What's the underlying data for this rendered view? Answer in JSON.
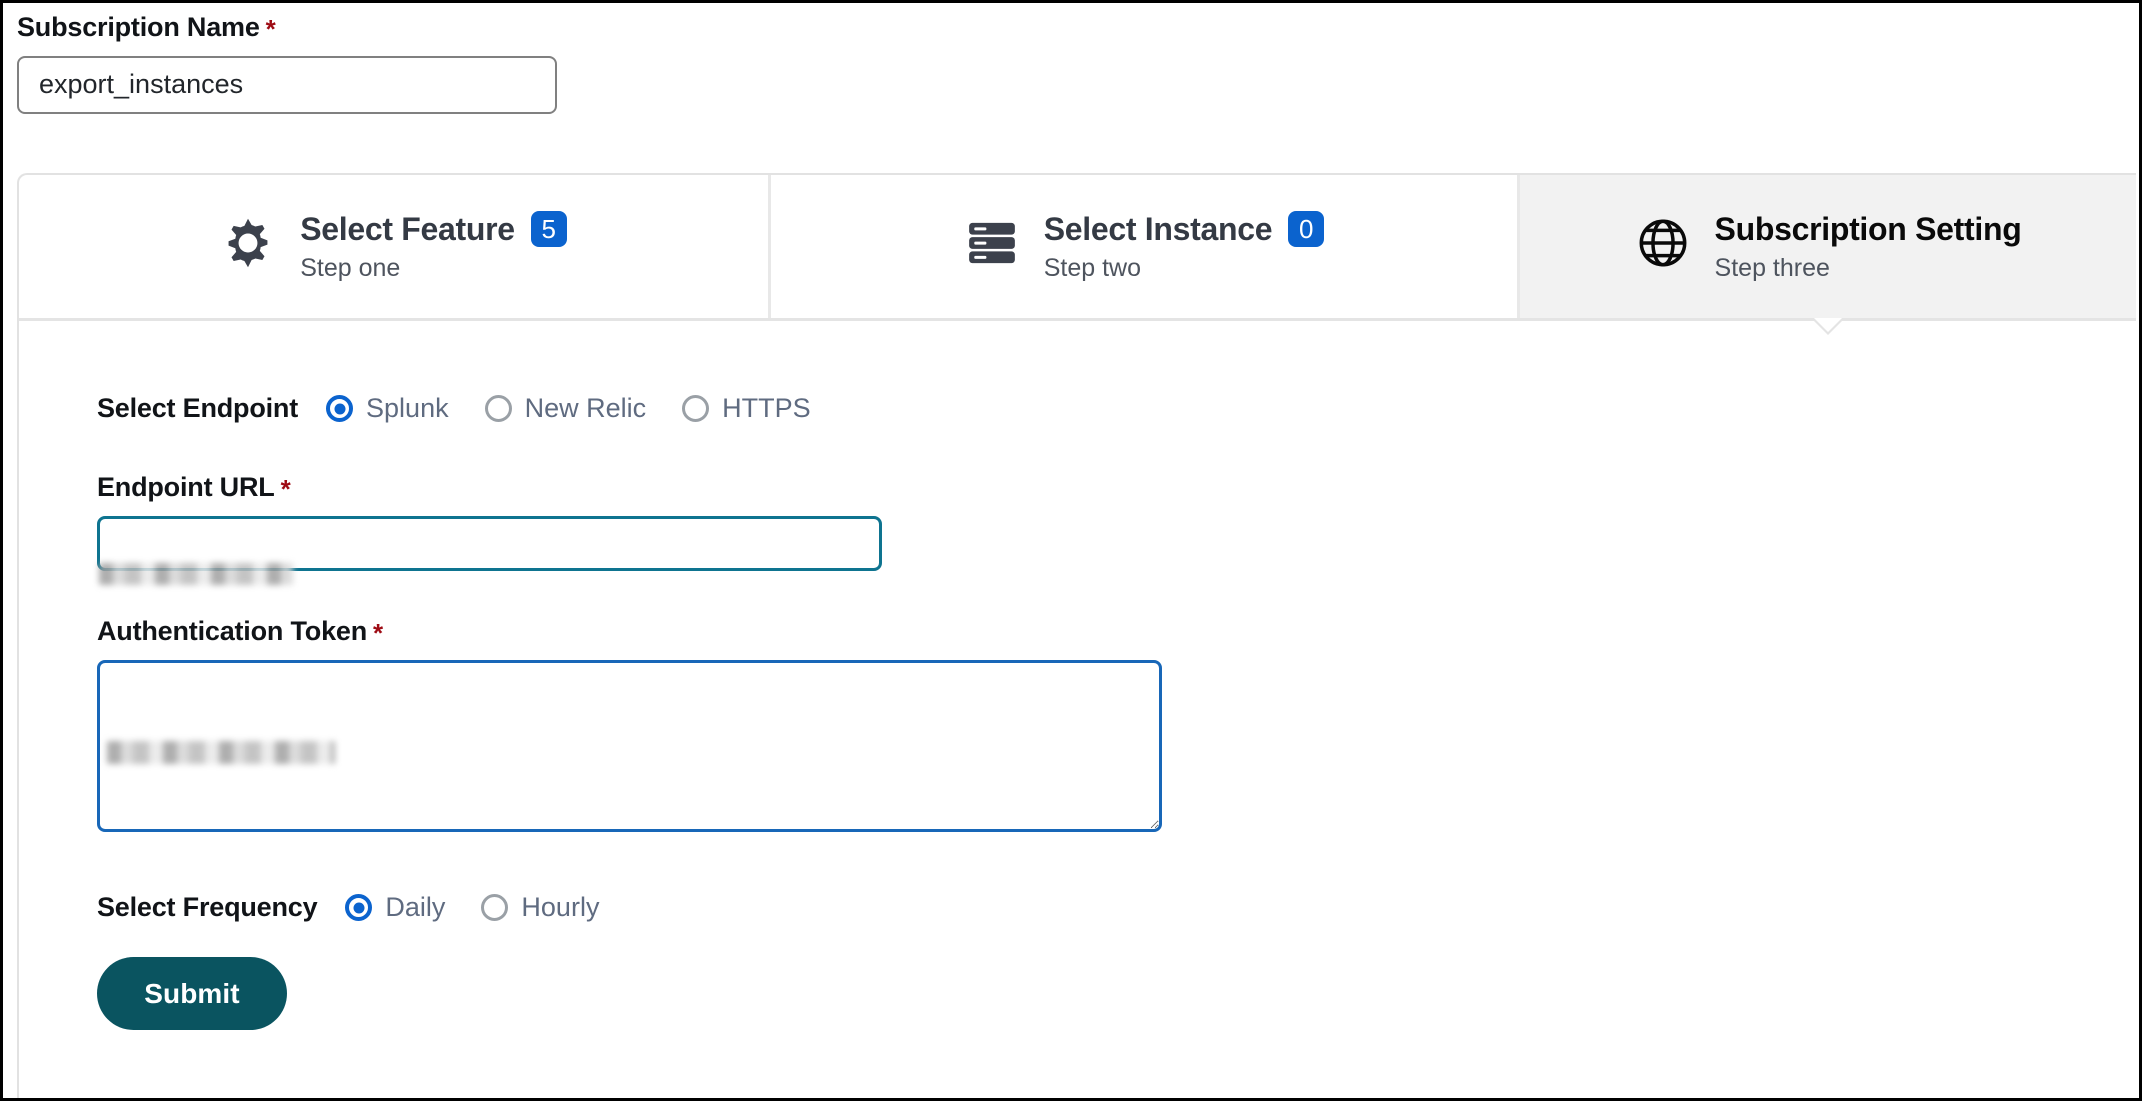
{
  "form": {
    "subscription_name": {
      "label": "Subscription Name",
      "required_marker": "*",
      "value": "export_instances",
      "placeholder": "Subscription Name"
    }
  },
  "stepper": {
    "tabs": [
      {
        "icon": "gear-icon",
        "title": "Select Feature",
        "badge": "5",
        "subtitle": "Step one",
        "active": false
      },
      {
        "icon": "server-stack-icon",
        "title": "Select Instance",
        "badge": "0",
        "subtitle": "Step two",
        "active": false
      },
      {
        "icon": "globe-icon",
        "title": "Subscription Setting",
        "badge": "",
        "subtitle": "Step three",
        "active": true
      }
    ]
  },
  "panel": {
    "endpoint": {
      "label": "Select Endpoint",
      "options": [
        {
          "label": "Splunk",
          "selected": true
        },
        {
          "label": "New Relic",
          "selected": false
        },
        {
          "label": "HTTPS",
          "selected": false
        }
      ]
    },
    "endpoint_url": {
      "label": "Endpoint URL",
      "required_marker": "*",
      "value": "",
      "placeholder": "Endpoint URL",
      "redacted": true
    },
    "auth_token": {
      "label": "Authentication Token",
      "required_marker": "*",
      "value": "",
      "placeholder": "Authentication Token",
      "redacted": true
    },
    "frequency": {
      "label": "Select Frequency",
      "options": [
        {
          "label": "Daily",
          "selected": true
        },
        {
          "label": "Hourly",
          "selected": false
        }
      ]
    },
    "submit_label": "Submit"
  },
  "colors": {
    "badge_blue": "#0b63ce",
    "radio_blue": "#0b63ce",
    "url_border_teal": "#0e7490",
    "token_border_blue": "#1867b8",
    "submit_teal": "#0a5460",
    "required_red": "#9e0b14",
    "active_tab_bg": "#f2f2f2"
  }
}
